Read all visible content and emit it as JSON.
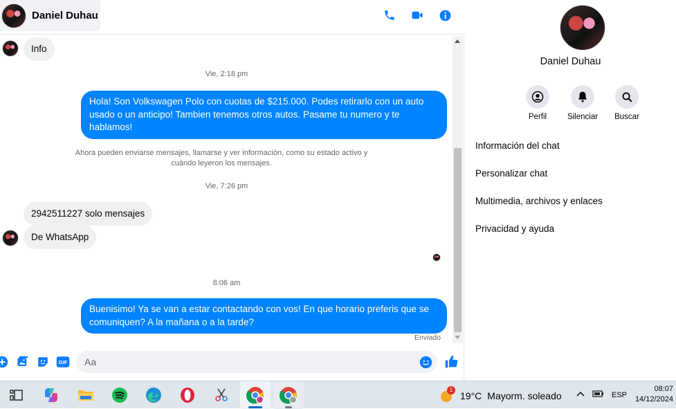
{
  "header": {
    "contact_name": "Daniel Duhau"
  },
  "messages": {
    "info_bubble": "Info",
    "ts1": "Vie, 2:18 pm",
    "out1": "Hola! Son Volkswagen Polo con cuotas de $215.000. Podes retirarlo con un auto usado o un anticipo! Tambien tenemos otros autos. Pasame tu numero y te hablamos!",
    "system": "Ahora pueden enviarse mensajes, llamarse y ver información, como su estado activo y cuándo leyeron los mensajes.",
    "ts2": "Vie, 7:26 pm",
    "in1": "2942511227 solo mensajes",
    "in2": "De WhatsApp",
    "ts3": "8:06 am",
    "out2": "Buenisimo! Ya se van a estar contactando con vos! En que horario preferis que se comuniquen? A la mañana o a la tarde?",
    "status": "Enviado"
  },
  "composer": {
    "placeholder": "Aa"
  },
  "info": {
    "name": "Daniel Duhau",
    "actions": [
      "Perfil",
      "Silenciar",
      "Buscar"
    ],
    "menu": [
      "Información del chat",
      "Personalizar chat",
      "Multimedia, archivos y enlaces",
      "Privacidad y ayuda"
    ]
  },
  "taskbar": {
    "weather_temp": "19°C",
    "weather_desc": "Mayorm. soleado",
    "weather_badge": "1",
    "lang": "ESP",
    "time": "08:07",
    "date": "14/12/2024"
  },
  "colors": {
    "accent": "#0084ff",
    "bubble_in": "#f0f0f0",
    "taskbar": "#dfe6ec"
  }
}
